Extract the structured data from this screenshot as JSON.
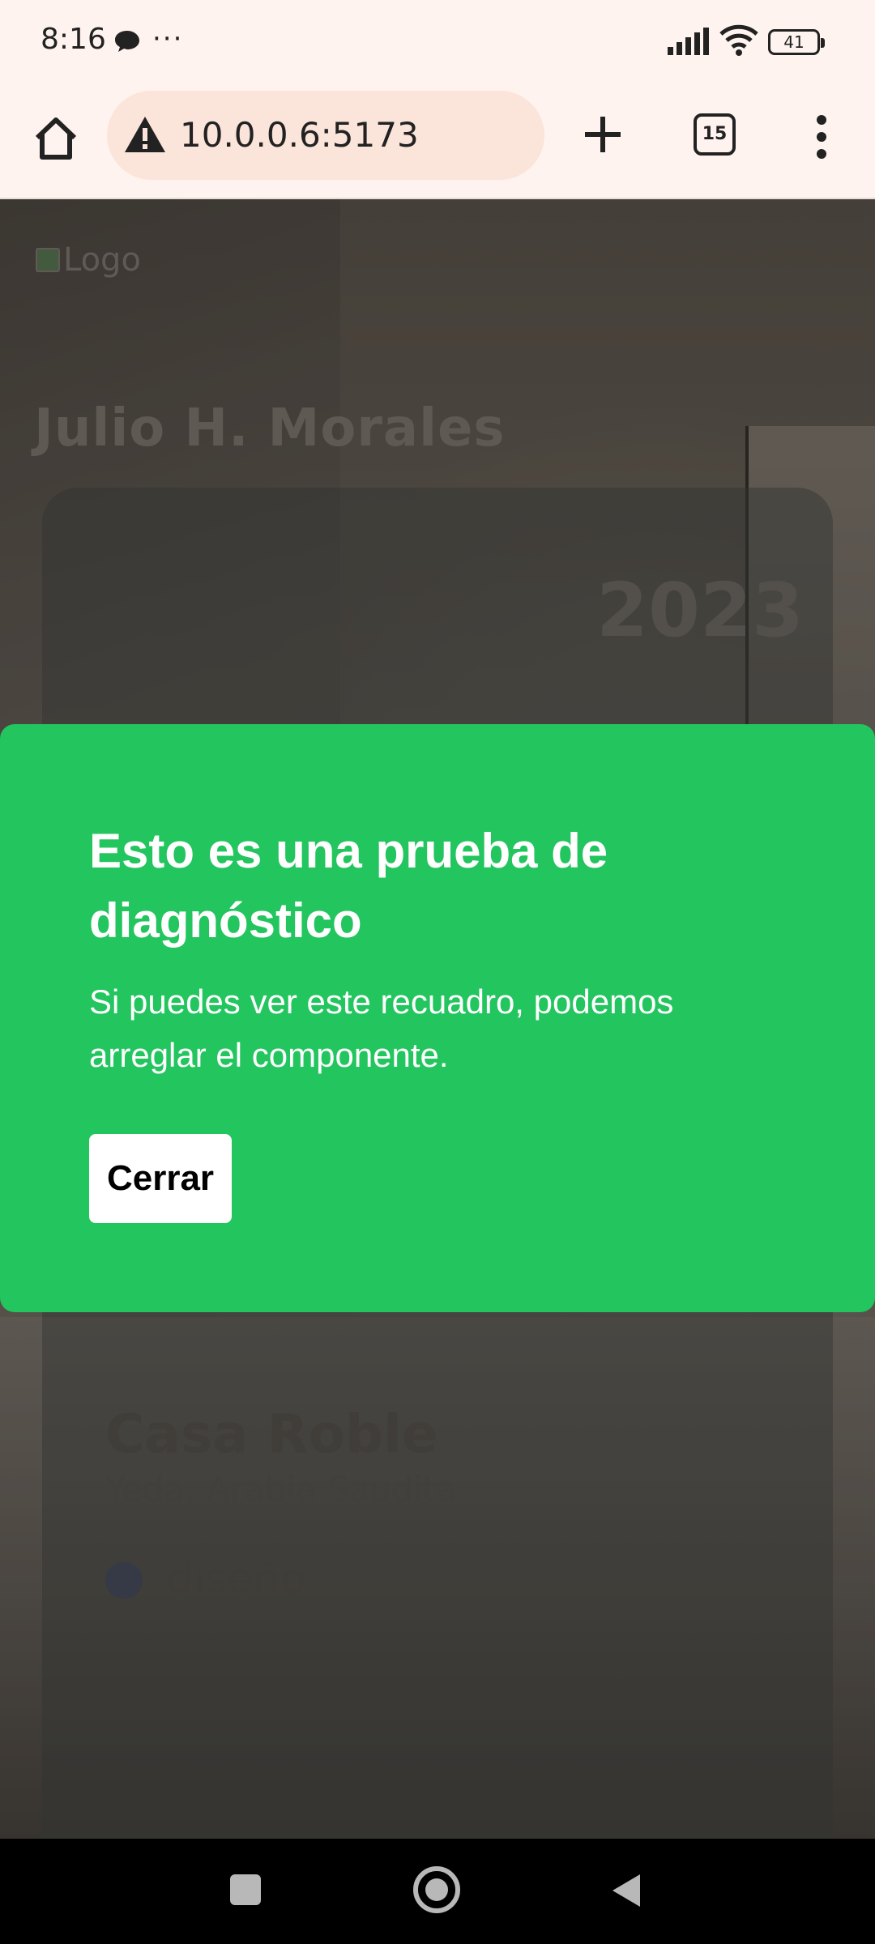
{
  "status_bar": {
    "time": "8:16",
    "more_notifications": "···",
    "battery": "41"
  },
  "browser": {
    "url": "10.0.0.6:5173",
    "tab_count": "15"
  },
  "page": {
    "logo_alt": "Logo",
    "owner_name": "Julio H. Morales",
    "project": {
      "year": "2023",
      "title": "Casa Roble",
      "location": "Yeda, Arabia Saudita",
      "tag": "diseño"
    }
  },
  "modal": {
    "title": "Esto es una prueba de diagnóstico",
    "body": "Si puedes ver este recuadro, podemos arreglar el componente.",
    "close_label": "Cerrar"
  },
  "colors": {
    "modal_bg": "#22c55e",
    "browser_chrome": "#fff3ef",
    "url_bar": "#fbe4da"
  }
}
